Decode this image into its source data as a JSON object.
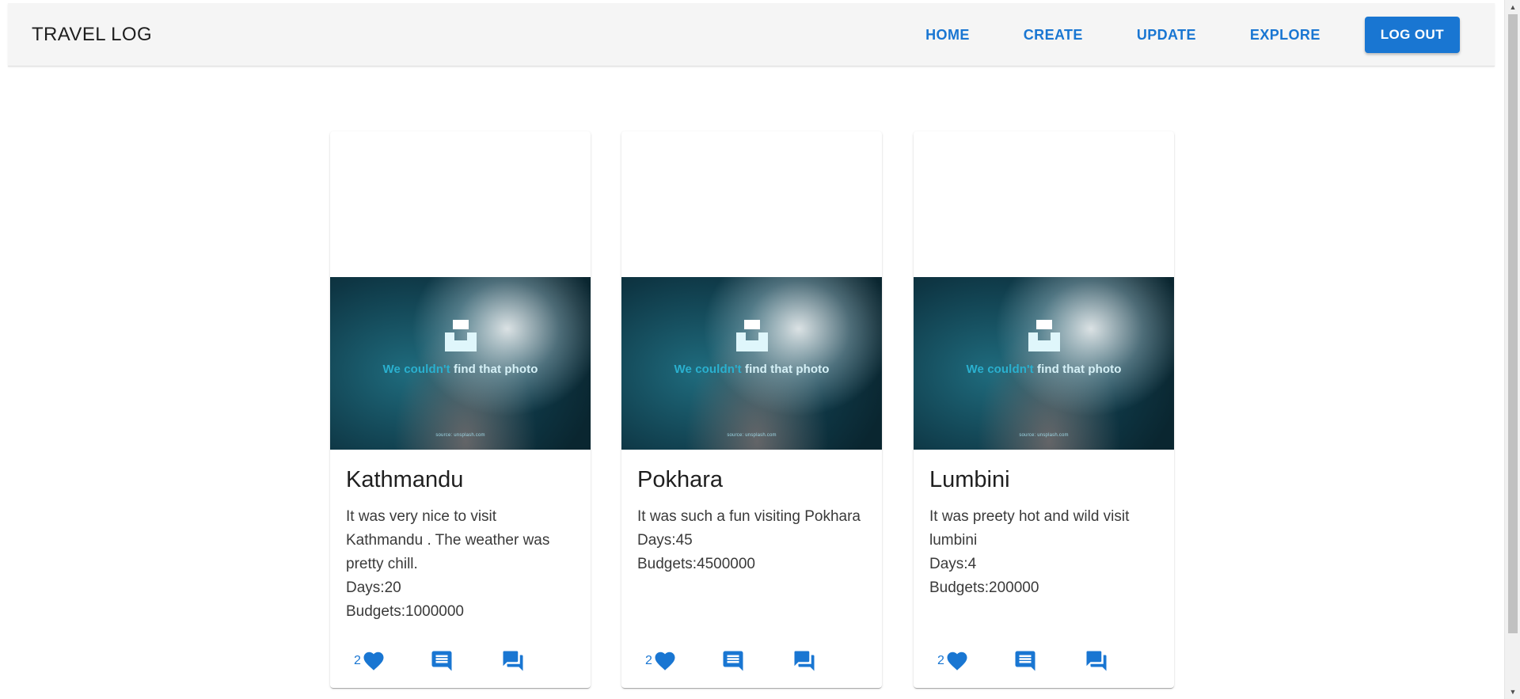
{
  "appbar": {
    "brand": "TRAVEL LOG",
    "nav": [
      "HOME",
      "CREATE",
      "UPDATE",
      "EXPLORE"
    ],
    "logout_label": "LOG OUT"
  },
  "media_placeholder": {
    "text_part1": "We couldn't ",
    "text_part2": "find that photo",
    "source": "source: unsplash.com"
  },
  "cards": [
    {
      "title": "Kathmandu",
      "description": "It was very nice to visit Kathmandu . The weather was pretty chill.",
      "days": "Days:20",
      "budget": "Budgets:1000000",
      "likes": "2"
    },
    {
      "title": "Pokhara",
      "description": "It was such a fun visiting Pokhara",
      "days": "Days:45",
      "budget": "Budgets:4500000",
      "likes": "2"
    },
    {
      "title": "Lumbini",
      "description": "It was preety hot and wild visit lumbini",
      "days": "Days:4",
      "budget": "Budgets:200000",
      "likes": "2"
    }
  ],
  "icons": {
    "like": "heart-icon",
    "comment": "comment-icon",
    "forum": "forum-icon"
  },
  "colors": {
    "primary": "#1976d2",
    "appbar_bg": "#f5f5f5"
  }
}
